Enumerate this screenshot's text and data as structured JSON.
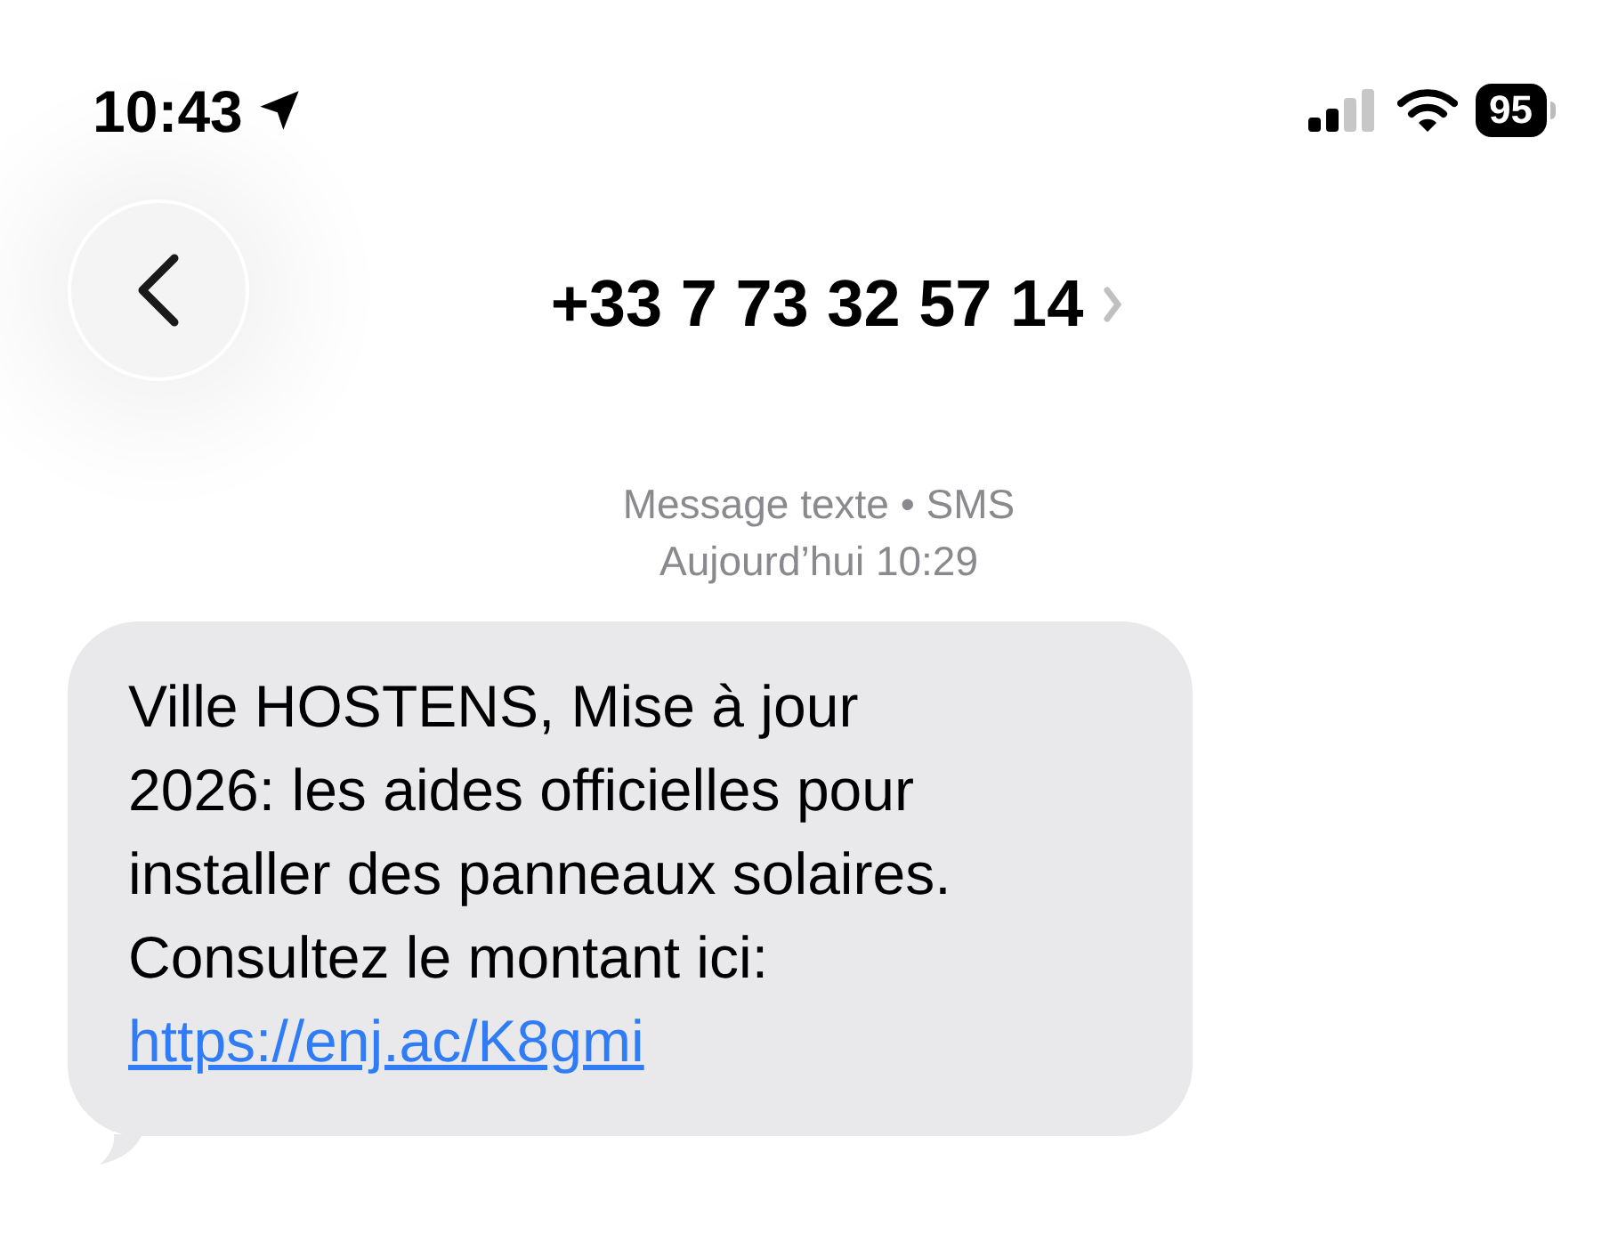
{
  "status_bar": {
    "time": "10:43",
    "battery": "95"
  },
  "header": {
    "contact": "+33 7 73 32 57 14"
  },
  "meta": {
    "service": "Message texte • SMS",
    "timestamp": "Aujourd’hui 10:29"
  },
  "messages": [
    {
      "lines": [
        "Ville HOSTENS, Mise à jour",
        "2026: les aides officielles pour",
        "installer des panneaux solaires.",
        "Consultez le montant ici:"
      ],
      "link": "https://enj.ac/K8gmi"
    }
  ]
}
